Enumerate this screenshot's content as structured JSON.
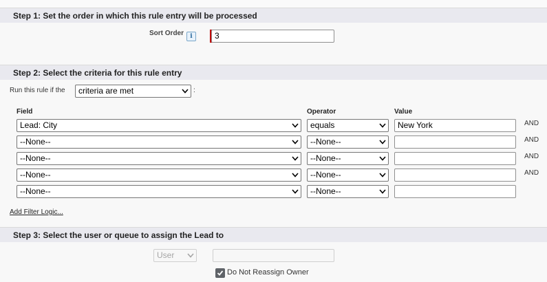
{
  "step1": {
    "header": "Step 1: Set the order in which this rule entry will be processed",
    "sort_order_label": "Sort Order",
    "info_glyph": "i",
    "sort_order_value": "3"
  },
  "step2": {
    "header": "Step 2: Select the criteria for this rule entry",
    "run_label": "Run this rule if the",
    "run_value": "criteria are met",
    "run_suffix": ":",
    "col_field": "Field",
    "col_operator": "Operator",
    "col_value": "Value",
    "rows": [
      {
        "field": "Lead: City",
        "operator": "equals",
        "value": "New York",
        "conj": "AND"
      },
      {
        "field": "--None--",
        "operator": "--None--",
        "value": "",
        "conj": "AND"
      },
      {
        "field": "--None--",
        "operator": "--None--",
        "value": "",
        "conj": "AND"
      },
      {
        "field": "--None--",
        "operator": "--None--",
        "value": "",
        "conj": "AND"
      },
      {
        "field": "--None--",
        "operator": "--None--",
        "value": "",
        "conj": ""
      }
    ],
    "add_filter_logic": "Add Filter Logic..."
  },
  "step3": {
    "header": "Step 3: Select the user or queue to assign the Lead to",
    "assignee_type": "User",
    "assignee_value": "",
    "do_not_reassign_label": "Do Not Reassign Owner",
    "do_not_reassign_checked": true
  }
}
